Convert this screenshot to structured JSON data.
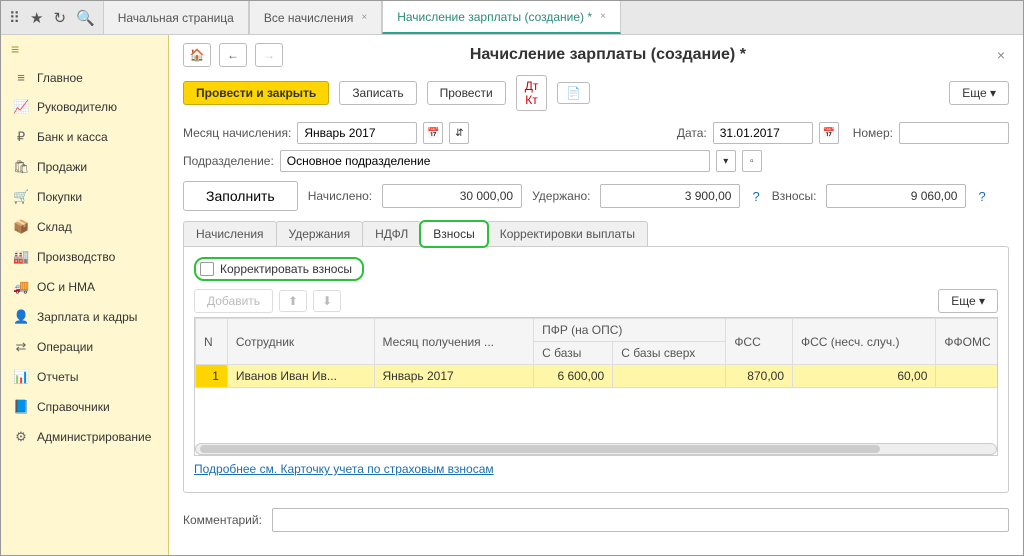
{
  "tabs": {
    "home": "Начальная страница",
    "all": "Все начисления",
    "current": "Начисление зарплаты (создание) *"
  },
  "sidebar": {
    "items": [
      {
        "icon": "≡",
        "label": "Главное"
      },
      {
        "icon": "📈",
        "label": "Руководителю"
      },
      {
        "icon": "₽",
        "label": "Банк и касса"
      },
      {
        "icon": "🛍",
        "label": "Продажи"
      },
      {
        "icon": "🛒",
        "label": "Покупки"
      },
      {
        "icon": "📦",
        "label": "Склад"
      },
      {
        "icon": "🏭",
        "label": "Производство"
      },
      {
        "icon": "🚚",
        "label": "ОС и НМА"
      },
      {
        "icon": "👤",
        "label": "Зарплата и кадры"
      },
      {
        "icon": "⇄",
        "label": "Операции"
      },
      {
        "icon": "📊",
        "label": "Отчеты"
      },
      {
        "icon": "📘",
        "label": "Справочники"
      },
      {
        "icon": "⚙",
        "label": "Администрирование"
      }
    ]
  },
  "header": {
    "title": "Начисление зарплаты (создание) *"
  },
  "toolbar": {
    "run_close": "Провести и закрыть",
    "save": "Записать",
    "run": "Провести",
    "more": "Еще ▾"
  },
  "fields": {
    "month_label": "Месяц начисления:",
    "month_value": "Январь 2017",
    "date_label": "Дата:",
    "date_value": "31.01.2017",
    "number_label": "Номер:",
    "number_value": "",
    "dept_label": "Подразделение:",
    "dept_value": "Основное подразделение"
  },
  "summary": {
    "fill": "Заполнить",
    "accrued_label": "Начислено:",
    "accrued_value": "30 000,00",
    "withheld_label": "Удержано:",
    "withheld_value": "3 900,00",
    "contrib_label": "Взносы:",
    "contrib_value": "9 060,00"
  },
  "tabs2": {
    "t1": "Начисления",
    "t2": "Удержания",
    "t3": "НДФЛ",
    "t4": "Взносы",
    "t5": "Корректировки выплаты"
  },
  "contrib_tab": {
    "correct_label": "Корректировать взносы",
    "add": "Добавить",
    "more": "Еще ▾",
    "columns": {
      "n": "N",
      "emp": "Сотрудник",
      "month": "Месяц получения ...",
      "pfr": "ПФР (на ОПС)",
      "base": "С базы",
      "over": "С базы сверх",
      "fss": "ФСС",
      "fss_ns": "ФСС (несч. случ.)",
      "ffoms": "ФФОМС"
    },
    "rows": [
      {
        "n": "1",
        "emp": "Иванов Иван Ив...",
        "month": "Январь 2017",
        "base": "6 600,00",
        "over": "",
        "fss": "870,00",
        "fss_ns": "60,00",
        "ffoms": ""
      }
    ],
    "footer_link": "Подробнее см. Карточку учета по страховым взносам"
  },
  "comment": {
    "label": "Комментарий:",
    "value": ""
  }
}
